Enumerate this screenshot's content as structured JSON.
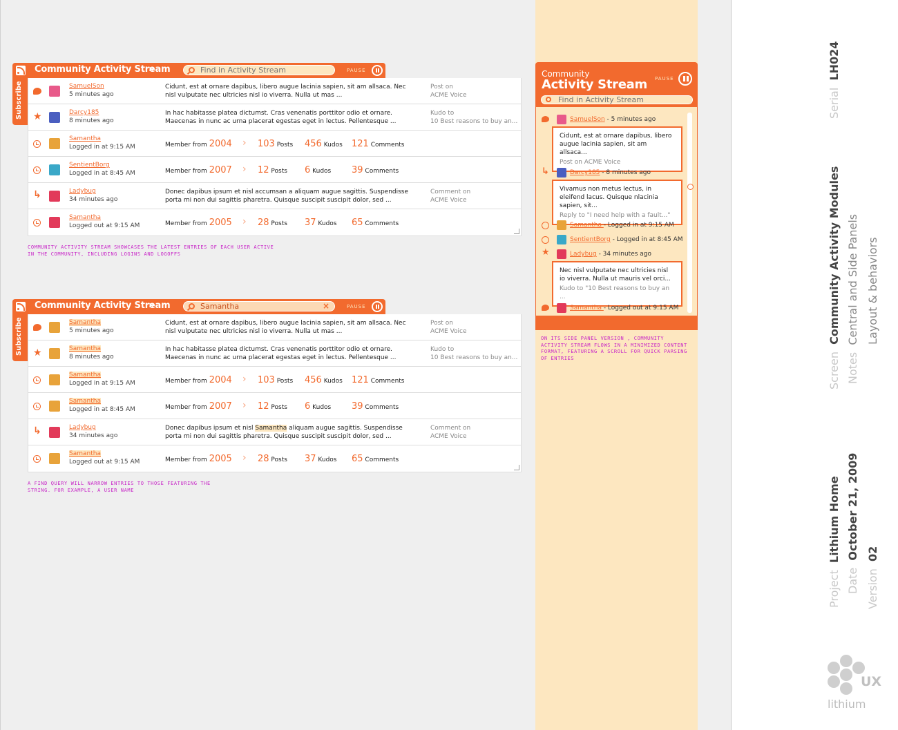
{
  "module": {
    "title": "Community Activity Stream",
    "chevron": "»",
    "pause_label": "PAUSE",
    "subscribe_label": "Subscribe"
  },
  "stream1": {
    "search_placeholder": "Find in Activity Stream",
    "search_value": "",
    "rows": [
      {
        "icon": "comment-icon",
        "avatar": "pink",
        "user": "SamuelSon",
        "time": "5 minutes ago",
        "msg1": "Cidunt, est at ornare dapibus, libero augue lacinia sapien, sit am allsaca. Nec",
        "msg2": "nisl vulputate nec ultricies nisl io viverra. Nulla ut mas ...",
        "ctx1": "Post on",
        "ctx2": "ACME Voice"
      },
      {
        "icon": "star-icon",
        "avatar": "blue",
        "user": "Darcy185",
        "time": "8 minutes ago",
        "msg1": "In hac habitasse platea dictumst. Cras venenatis porttitor odio et ornare.",
        "msg2": "Maecenas in nunc ac urna placerat egestas eget in lectus. Pellentesque ...",
        "ctx1": "Kudo to",
        "ctx2": "10 Best reasons to buy an..."
      },
      {
        "icon": "clock-icon",
        "avatar": "gold",
        "user": "Samantha",
        "time": "Logged in at 9:15 AM",
        "member_from": "Member from",
        "year": "2004",
        "posts": "103",
        "kudos": "456",
        "comments": "121"
      },
      {
        "icon": "clock-icon",
        "avatar": "teal",
        "user": "SentientBorg",
        "time": "Logged in at 8:45 AM",
        "member_from": "Member from",
        "year": "2007",
        "posts": "12",
        "kudos": "6",
        "comments": "39"
      },
      {
        "icon": "reply-icon",
        "avatar": "red",
        "user": "Ladybug",
        "time": "34 minutes ago",
        "msg1": "Donec dapibus ipsum et nisl accumsan a aliquam augue sagittis. Suspendisse",
        "msg2": "porta mi non dui sagittis pharetra. Quisque suscipit suscipit dolor, sed ...",
        "ctx1": "Comment on",
        "ctx2": "ACME Voice"
      },
      {
        "icon": "clock-icon",
        "avatar": "red",
        "user": "Samantha",
        "time": "Logged out at 9:15 AM",
        "member_from": "Member from",
        "year": "2005",
        "posts": "28",
        "kudos": "37",
        "comments": "65"
      }
    ],
    "note1": "Community activity stream showcases the latest entries of each user active",
    "note2": "in the community, including logins and logoffs"
  },
  "stream2": {
    "search_value": "Samantha",
    "rows": [
      {
        "user": "Samantha",
        "time": "5 minutes ago",
        "msg1": "Cidunt, est at ornare dapibus, libero augue lacinia sapien, sit am allsaca. Nec",
        "msg2": "nisl vulputate nec ultricies nisl io viverra. Nulla ut mas ...",
        "ctx1": "Post on",
        "ctx2": "ACME Voice"
      },
      {
        "user": "Samantha",
        "time": "8 minutes ago",
        "msg1": "In hac habitasse platea dictumst. Cras venenatis porttitor odio et ornare.",
        "msg2": "Maecenas in nunc ac urna placerat egestas eget in lectus. Pellentesque ...",
        "ctx1": "Kudo to",
        "ctx2": "10 Best reasons to buy an..."
      },
      {
        "user": "Samantha",
        "time": "Logged in at 9:15 AM",
        "member_from": "Member from",
        "year": "2004",
        "posts": "103",
        "kudos": "456",
        "comments": "121"
      },
      {
        "user": "Samantha",
        "time": "Logged in at 8:45 AM",
        "member_from": "Member from",
        "year": "2007",
        "posts": "12",
        "kudos": "6",
        "comments": "39"
      },
      {
        "user": "Ladybug",
        "time": "34 minutes ago",
        "msg1a": "Donec dapibus ipsum et nisl ",
        "msg1hl": "Samantha",
        "msg1b": " aliquam augue sagittis. Suspendisse",
        "msg2": "porta mi non dui sagittis pharetra. Quisque suscipit suscipit dolor, sed ...",
        "ctx1": "Comment on",
        "ctx2": "ACME Voice"
      },
      {
        "user": "Samantha",
        "time": "Logged out at 9:15 AM",
        "member_from": "Member from",
        "year": "2005",
        "posts": "28",
        "kudos": "37",
        "comments": "65"
      }
    ],
    "note1": "A find query will narrow entries to those featuring the",
    "note2": "string. For example, a user name"
  },
  "stats_labels": {
    "posts": "Posts",
    "kudos": "Kudos",
    "comments": "Comments"
  },
  "side": {
    "title_line1": "Community",
    "title_line2": "Activity Stream",
    "pause_label": "PAUSE",
    "search_placeholder": "Find in Activity Stream",
    "e1_user": "SamuelSon",
    "e1_time": " - 5 minutes ago",
    "c1_text": "Cidunt, est at ornare dapibus, libero augue lacinia sapien, sit am allsaca...",
    "c1_sub": "Post on ACME Voice",
    "e2_user": "Darcy185",
    "e2_time": " - 8 minutes ago",
    "c2_text": "Vivamus non metus lectus, in eleifend lacus. Quisque nlacinia sapien, sit...",
    "c2_sub": "Reply  to \"I need help with a fault...\"",
    "e3_user": "Samantha ",
    "e3_time": "- Logged in at 9:15 AM",
    "e4_user": "SentientBorg",
    "e4_time": " - Logged in at 8:45 AM",
    "e5_user": "Ladybug",
    "e5_time": " - 34 minutes ago",
    "c3_text": "Nec nisl vulputate nec ultricies nisl io viverra. Nulla ut mauris vel orci...",
    "c3_sub": "Kudo to \"10 Best reasons to buy an ...",
    "e6_user": "Samantha ",
    "e6_time": "- Logged out at 9:15 AM",
    "note": "On its side panel version , Community activity stream flows in a minimized content format, featuring a scroll for quick parsing of entries"
  },
  "meta": {
    "serial_label": "Serial",
    "serial_value": "LH024",
    "screen_label": "Screen",
    "screen_value": "Community Activity Modules",
    "notes_label": "Notes",
    "notes_value1": "Central and Side Panels",
    "notes_value2": "Layout & behaviors",
    "project_label": "Project",
    "project_value": "Lithium Home",
    "date_label": "Date",
    "date_value": "October 21, 2009",
    "version_label": "Version",
    "version_value": "02",
    "logo_ux": "UX",
    "logo_name": "lithium"
  }
}
